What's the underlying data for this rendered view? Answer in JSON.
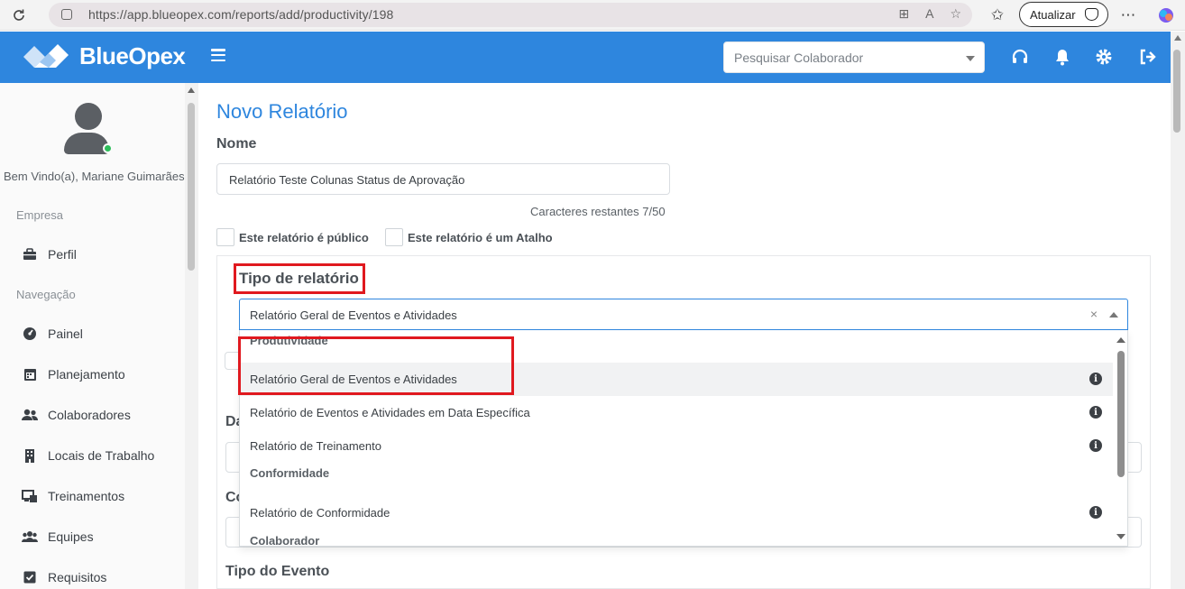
{
  "browser": {
    "url": "https://app.blueopex.com/reports/add/productivity/198",
    "update_label": "Atualizar"
  },
  "header": {
    "brand": "BlueOpex",
    "search_placeholder": "Pesquisar Colaborador",
    "accent": "#2e86de"
  },
  "sidebar": {
    "welcome": "Bem Vindo(a), Mariane Guimarães",
    "section_company": "Empresa",
    "section_nav": "Navegação",
    "items": [
      {
        "label": "Perfil",
        "icon": "briefcase-icon"
      },
      {
        "label": "Painel",
        "icon": "dashboard-icon"
      },
      {
        "label": "Planejamento",
        "icon": "calendar-icon"
      },
      {
        "label": "Colaboradores",
        "icon": "users-icon"
      },
      {
        "label": "Locais de Trabalho",
        "icon": "building-icon"
      },
      {
        "label": "Treinamentos",
        "icon": "training-icon"
      },
      {
        "label": "Equipes",
        "icon": "team-icon"
      },
      {
        "label": "Requisitos",
        "icon": "checkbox-icon"
      }
    ]
  },
  "form": {
    "title": "Novo Relatório",
    "name_label": "Nome",
    "name_value": "Relatório Teste Colunas Status de Aprovação",
    "chars_remaining": "Caracteres restantes 7/50",
    "public_label": "Este relatório é público",
    "shortcut_label": "Este relatório é um Atalho",
    "type_label": "Tipo de relatório",
    "type_value": "Relatório Geral de Eventos e Atividades",
    "clear_symbol": "×",
    "behind_label_1": "Da",
    "behind_label_2": "Co",
    "event_type_label": "Tipo do Evento"
  },
  "dropdown": {
    "options": [
      {
        "label": "Produtividade",
        "group": true
      },
      {
        "label": "Relatório Geral de Eventos e Atividades",
        "group": false,
        "info": true,
        "active": true
      },
      {
        "label": "Relatório de Eventos e Atividades em Data Específica",
        "group": false,
        "info": true
      },
      {
        "label": "Relatório de Treinamento",
        "group": false,
        "info": true
      },
      {
        "label": "Conformidade",
        "group": true
      },
      {
        "label": "Relatório de Conformidade",
        "group": false,
        "info": true
      },
      {
        "label": "Colaborador",
        "group": true
      }
    ],
    "info_symbol": "i"
  }
}
